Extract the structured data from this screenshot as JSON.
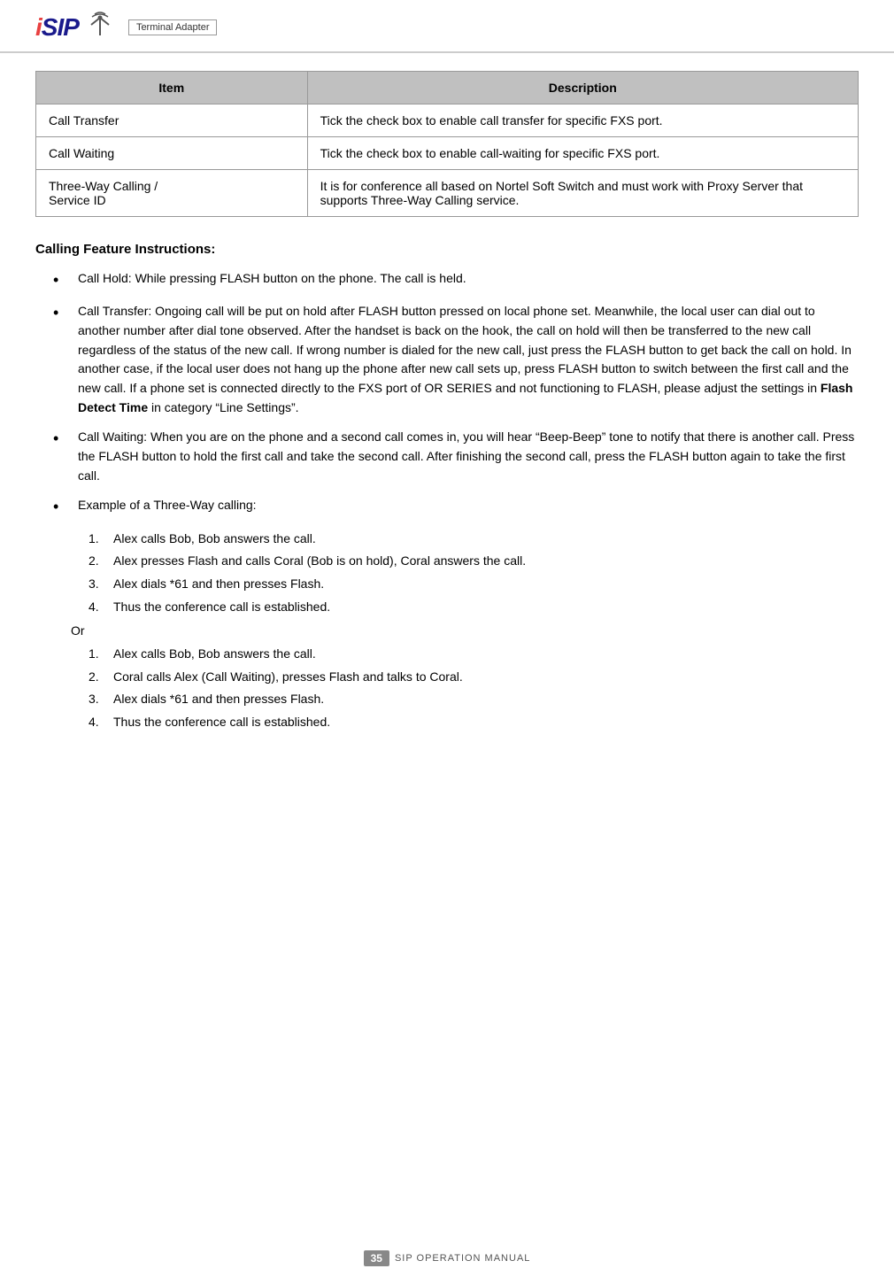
{
  "header": {
    "logo_text": "Terminal Adapter"
  },
  "table": {
    "col1_header": "Item",
    "col2_header": "Description",
    "rows": [
      {
        "item": "Call Transfer",
        "description": "Tick the check box to enable call transfer for specific FXS port."
      },
      {
        "item": "Call Waiting",
        "description": "Tick the check box to enable call-waiting for specific FXS port."
      },
      {
        "item": "Three-Way Calling /\nService ID",
        "description": "It is for conference all based on Nortel Soft Switch and must work with Proxy Server that supports Three-Way Calling service."
      }
    ]
  },
  "section": {
    "title": "Calling Feature Instructions:",
    "bullets": [
      {
        "text": "Call Hold: While pressing FLASH button on the phone. The call is held."
      },
      {
        "text": "Call Transfer: Ongoing call will be put on hold after FLASH button pressed on local phone set. Meanwhile, the local user can dial out to another number after dial tone observed. After the handset is back on the hook, the call on hold will then be transferred to the new call regardless of the status of the new call. If wrong number is dialed for the new call, just press the FLASH button to get back the call on hold. In another case, if the local user does not hang up the phone after new call sets up, press FLASH button to switch between the first call and the new call. If a phone set is connected directly to the FXS port of OR SERIES and not functioning to FLASH, please adjust the settings in Flash Detect Time in category “Line Settings”."
      },
      {
        "text": "Call Waiting: When you are on the phone and a second call comes in, you will hear “Beep-Beep” tone to notify that there is another call. Press the FLASH button to hold the first call and take the second call. After finishing the second call, press the FLASH button again to take the first call."
      },
      {
        "text": "Example of a Three-Way calling:"
      }
    ],
    "numbered_list_1": [
      "Alex calls Bob, Bob answers the call.",
      "Alex presses Flash and calls Coral (Bob is on hold), Coral answers the call.",
      "Alex dials *61 and then presses Flash.",
      "Thus the conference call is established."
    ],
    "or_text": "Or",
    "numbered_list_2": [
      "Alex calls Bob, Bob answers the call.",
      "Coral calls Alex (Call Waiting), presses Flash and talks to Coral.",
      "Alex dials *61 and then presses Flash.",
      "Thus the conference call is established."
    ]
  },
  "footer": {
    "page_number": "35",
    "manual_text": "SIP OPERATION MANUAL"
  }
}
